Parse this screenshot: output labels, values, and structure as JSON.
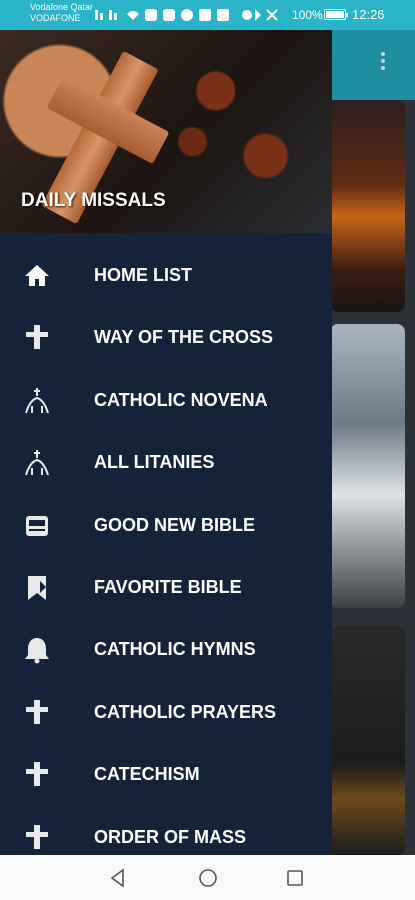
{
  "status_bar": {
    "carrier_line1": "Vodafone Qatar",
    "carrier_line2": "VODAFONE",
    "battery": "100%",
    "time": "12:26"
  },
  "drawer": {
    "header_title": "DAILY MISSALS",
    "items": [
      {
        "label": "HOME LIST",
        "icon": "home-icon"
      },
      {
        "label": "WAY OF THE CROSS",
        "icon": "cross-icon"
      },
      {
        "label": "CATHOLIC NOVENA",
        "icon": "altar-icon"
      },
      {
        "label": "ALL LITANIES",
        "icon": "altar-icon"
      },
      {
        "label": "GOOD NEW BIBLE",
        "icon": "bible-icon"
      },
      {
        "label": "FAVORITE BIBLE",
        "icon": "bookmark-bible-icon"
      },
      {
        "label": "CATHOLIC HYMNS",
        "icon": "bell-icon"
      },
      {
        "label": "CATHOLIC PRAYERS",
        "icon": "cross-icon"
      },
      {
        "label": "CATECHISM",
        "icon": "cross-icon"
      },
      {
        "label": "ORDER OF MASS",
        "icon": "cross-icon"
      }
    ]
  },
  "colors": {
    "status_bar": "#2bb3c9",
    "drawer_bg": "#15233a",
    "toolbar": "#1f8ea0"
  }
}
